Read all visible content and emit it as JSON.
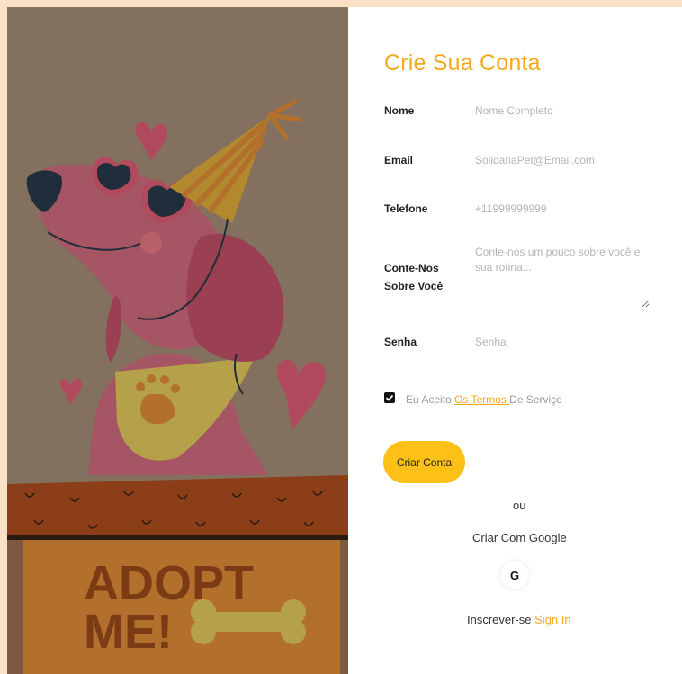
{
  "form": {
    "title": "Crie Sua Conta",
    "fields": [
      {
        "label": "Nome",
        "placeholder": "Nome Completo"
      },
      {
        "label": "Email",
        "placeholder": "SolidariaPet@Email.com"
      },
      {
        "label": "Telefone",
        "placeholder": "+11999999999"
      },
      {
        "label_line1": "Conte-Nos",
        "label_line2": "Sobre Você",
        "placeholder": "Conte-nos um pouco sobre você e sua rotina..."
      },
      {
        "label": "Senha",
        "placeholder": "Senha"
      }
    ],
    "terms": {
      "checked": true,
      "prefix": "Eu Aceito ",
      "link": "Os Termos ",
      "suffix": "De Serviço"
    },
    "submit_label": "Criar Conta",
    "separator": "ou",
    "google_label": "Criar Com Google",
    "google_icon_letter": "G",
    "signin_prefix": "Inscrever-se ",
    "signin_link": "Sign In"
  },
  "illustration": {
    "sign_line1": "ADOPT",
    "sign_line2": "ME!"
  },
  "colors": {
    "accent": "#f6a81a",
    "button": "#fcc016",
    "page_bg": "#fbe0c6"
  }
}
